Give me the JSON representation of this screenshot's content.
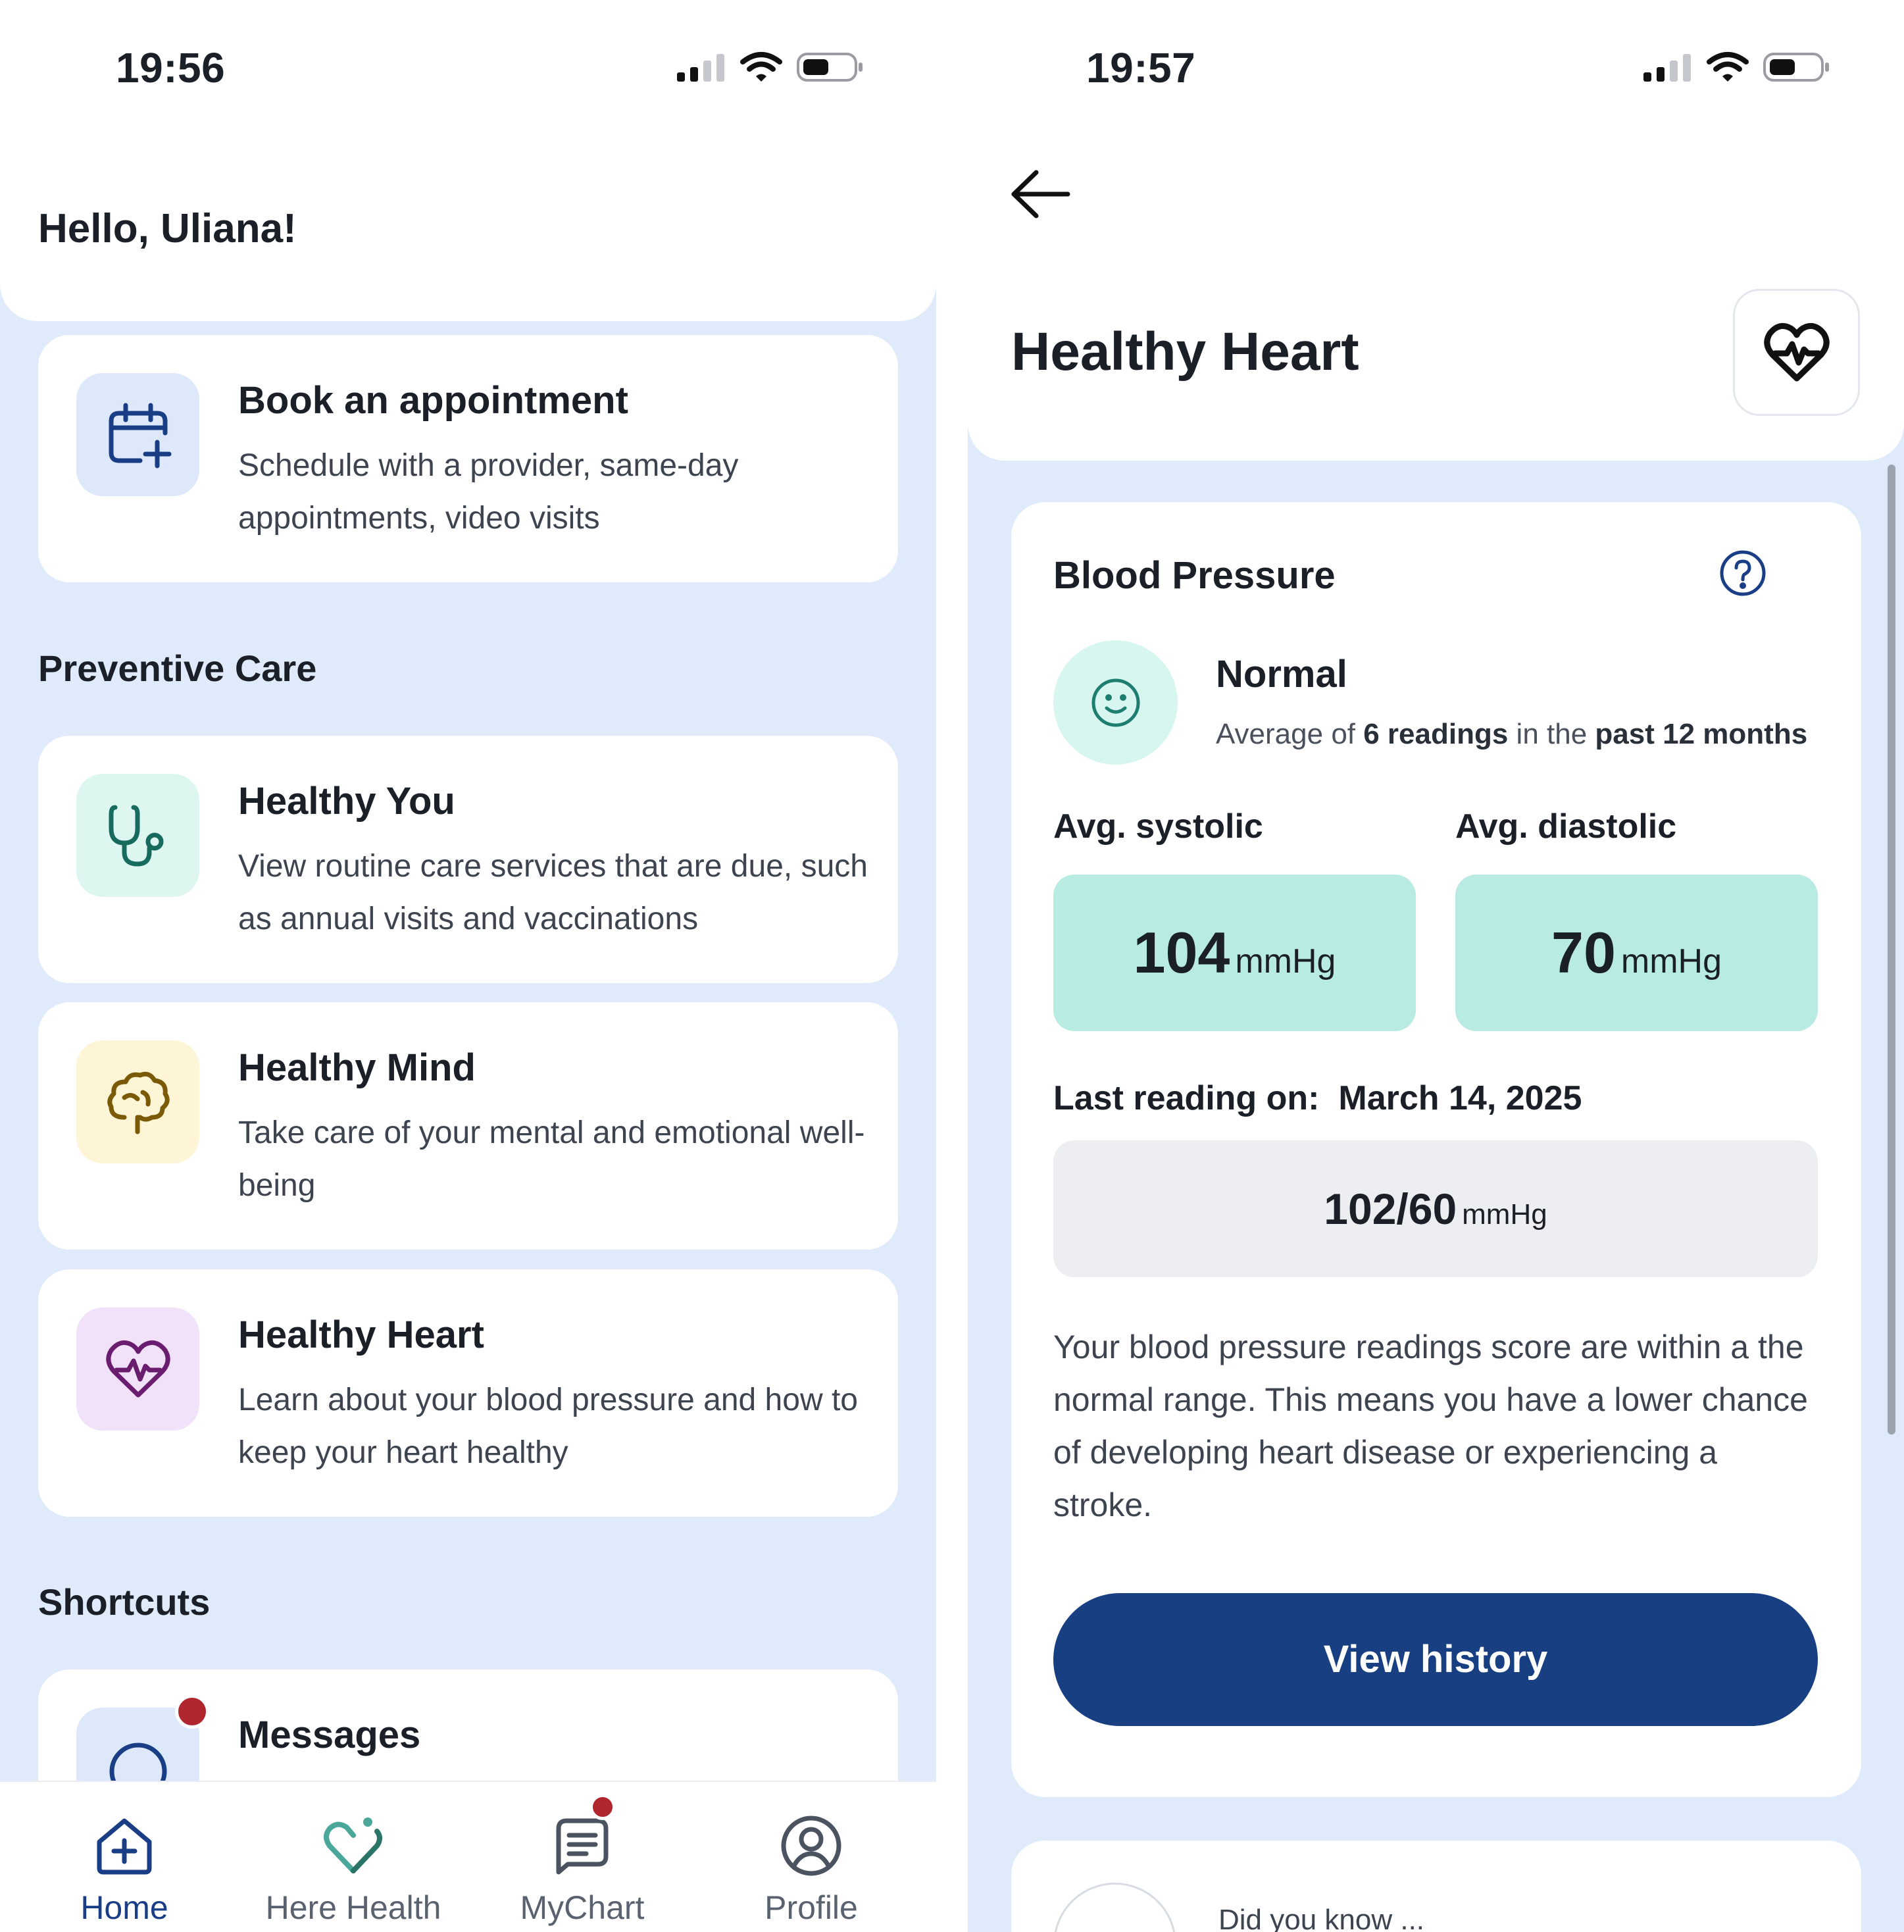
{
  "left": {
    "status": {
      "time": "19:56"
    },
    "greeting": "Hello, Uliana!",
    "appointment": {
      "title": "Book an appointment",
      "desc": "Schedule with a provider, same-day appointments, video visits"
    },
    "preventive": {
      "heading": "Preventive Care",
      "items": [
        {
          "title": "Healthy You",
          "desc": "View routine care services that are due, such as annual visits and vaccinations",
          "icon": "stethoscope-icon",
          "color": "#ddf7f0"
        },
        {
          "title": "Healthy Mind",
          "desc": "Take care of your mental and emotional well-being",
          "icon": "brain-icon",
          "color": "#fdf5d6"
        },
        {
          "title": "Healthy Heart",
          "desc": "Learn about your blood pressure and how to keep your heart healthy",
          "icon": "heart-pulse-icon",
          "color": "#f1e2f9"
        }
      ]
    },
    "shortcuts": {
      "heading": "Shortcuts",
      "messages": "Messages"
    },
    "tabs": [
      {
        "label": "Home",
        "icon": "home-icon",
        "active": true
      },
      {
        "label": "Here Health",
        "icon": "here-health-icon",
        "active": false
      },
      {
        "label": "MyChart",
        "icon": "mychart-icon",
        "active": false
      },
      {
        "label": "Profile",
        "icon": "profile-icon",
        "active": false
      }
    ]
  },
  "right": {
    "status": {
      "time": "19:57"
    },
    "title": "Healthy Heart",
    "bp": {
      "title": "Blood Pressure",
      "status": "Normal",
      "avg_prefix": "Average of ",
      "avg_readings": "6 readings",
      "avg_mid": " in the ",
      "avg_period": "past 12 months",
      "systolic_label": "Avg. systolic",
      "systolic_value": "104",
      "diastolic_label": "Avg. diastolic",
      "diastolic_value": "70",
      "unit": "mmHg",
      "last_label": "Last reading on:",
      "last_date": "March 14, 2025",
      "last_value": "102/60",
      "explanation": "Your blood pressure readings score are within a the normal range. This means you have a lower chance of developing heart disease or experiencing a stroke.",
      "history_button": "View history"
    },
    "did_you_know": "Did you know ..."
  },
  "colors": {
    "accent": "#173f82",
    "background": "#dfebfb",
    "value_box": "#b8ece2",
    "alert_dot": "#b0262e"
  }
}
